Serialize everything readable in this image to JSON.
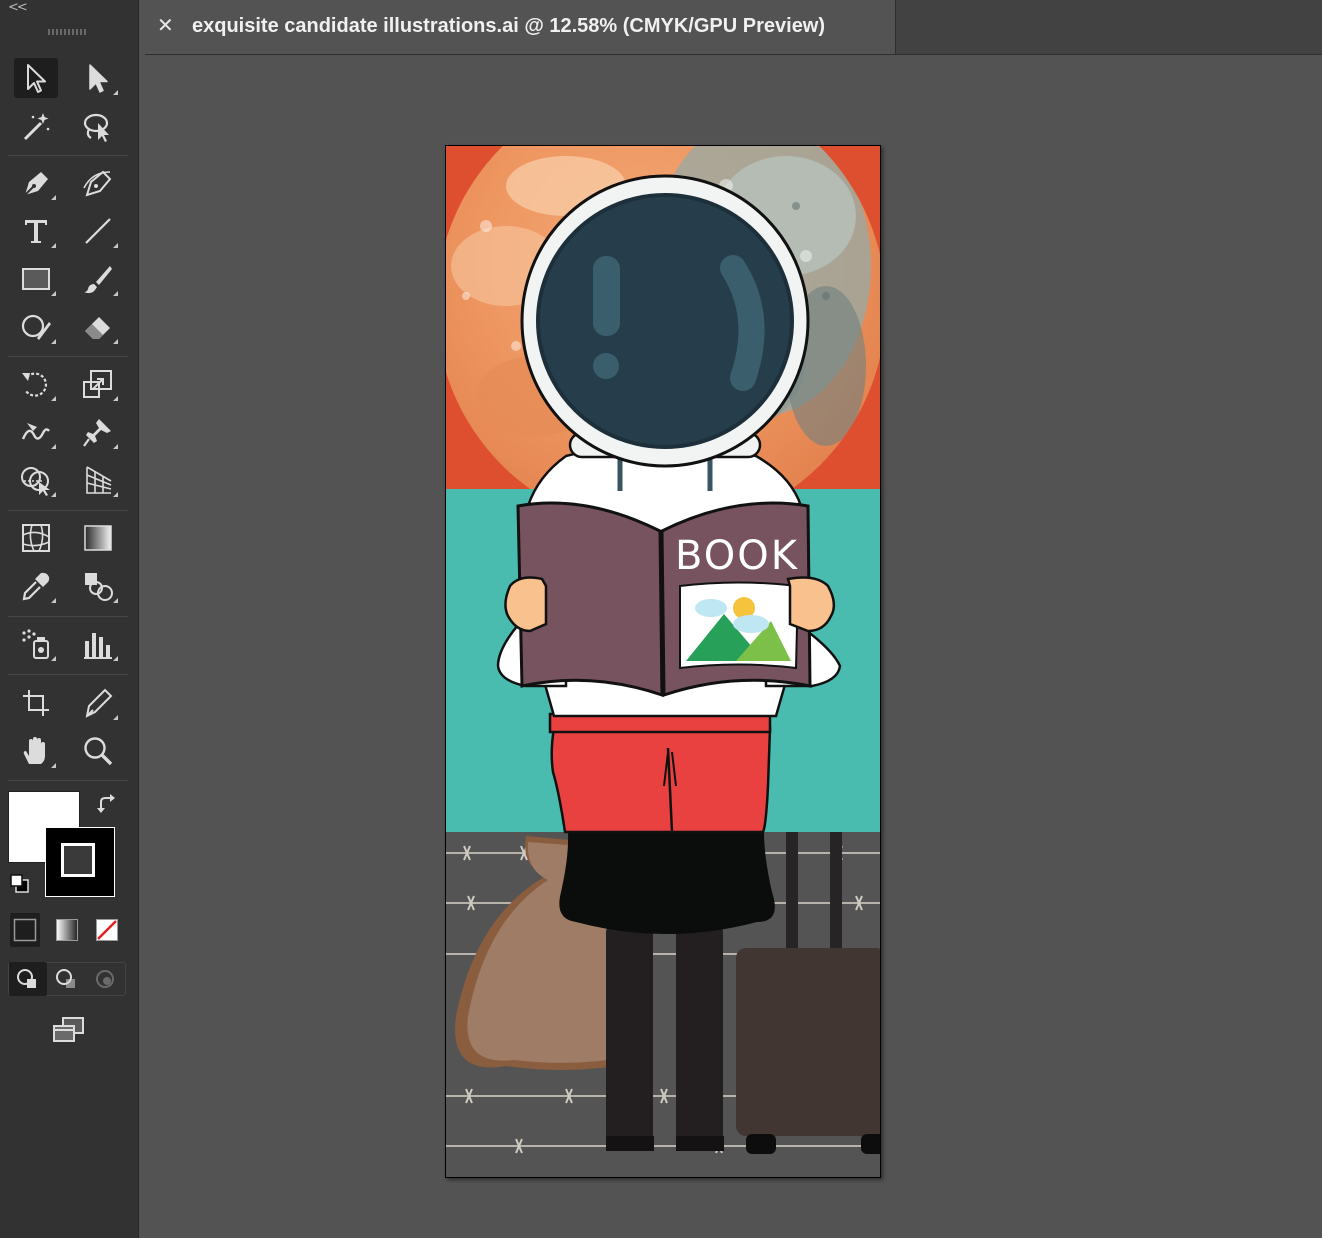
{
  "app": {
    "collapse_glyph": "<<"
  },
  "document_tab": {
    "close_glyph": "✕",
    "title": "exquisite candidate illustrations.ai @ 12.58% (CMYK/GPU Preview)"
  },
  "toolbar": {
    "tools": [
      {
        "name": "selection-tool",
        "icon": "arrow-icon",
        "active": true
      },
      {
        "name": "direct-selection-tool",
        "icon": "white-arrow-icon"
      },
      {
        "name": "magic-wand-tool",
        "icon": "magic-wand-icon"
      },
      {
        "name": "lasso-tool",
        "icon": "lasso-icon"
      },
      {
        "name": "pen-tool",
        "icon": "pen-icon"
      },
      {
        "name": "curvature-tool",
        "icon": "curvature-pen-icon"
      },
      {
        "name": "type-tool",
        "icon": "type-icon"
      },
      {
        "name": "line-segment-tool",
        "icon": "line-icon"
      },
      {
        "name": "rectangle-tool",
        "icon": "rectangle-icon"
      },
      {
        "name": "paintbrush-tool",
        "icon": "brush-icon"
      },
      {
        "name": "shaper-tool",
        "icon": "shaper-icon"
      },
      {
        "name": "eraser-tool",
        "icon": "eraser-icon"
      },
      {
        "name": "rotate-tool",
        "icon": "rotate-icon"
      },
      {
        "name": "scale-tool",
        "icon": "scale-icon"
      },
      {
        "name": "warp-tool",
        "icon": "warp-icon"
      },
      {
        "name": "puppet-warp-tool",
        "icon": "pin-icon"
      },
      {
        "name": "shape-builder-tool",
        "icon": "shape-builder-icon"
      },
      {
        "name": "perspective-grid-tool",
        "icon": "perspective-grid-icon"
      },
      {
        "name": "mesh-tool",
        "icon": "mesh-icon"
      },
      {
        "name": "gradient-tool",
        "icon": "gradient-icon"
      },
      {
        "name": "eyedropper-tool",
        "icon": "eyedropper-icon"
      },
      {
        "name": "blend-tool",
        "icon": "blend-icon"
      },
      {
        "name": "symbol-sprayer-tool",
        "icon": "symbol-sprayer-icon"
      },
      {
        "name": "column-graph-tool",
        "icon": "column-graph-icon"
      },
      {
        "name": "artboard-tool",
        "icon": "artboard-icon"
      },
      {
        "name": "slice-tool",
        "icon": "slice-icon"
      },
      {
        "name": "hand-tool",
        "icon": "hand-icon"
      },
      {
        "name": "zoom-tool",
        "icon": "zoom-icon"
      }
    ],
    "fill_color": "#ffffff",
    "stroke_color": "#000000",
    "draw_mode": "normal"
  },
  "artwork": {
    "book_label": "BOOK",
    "colors": {
      "sky": "#de4f30",
      "teal": "#49bcaf",
      "ground": "#545454",
      "helmet_visor": "#263e4b",
      "book_cover": "#76535f",
      "pants": "#e84140",
      "skin": "#f9c18e"
    }
  }
}
